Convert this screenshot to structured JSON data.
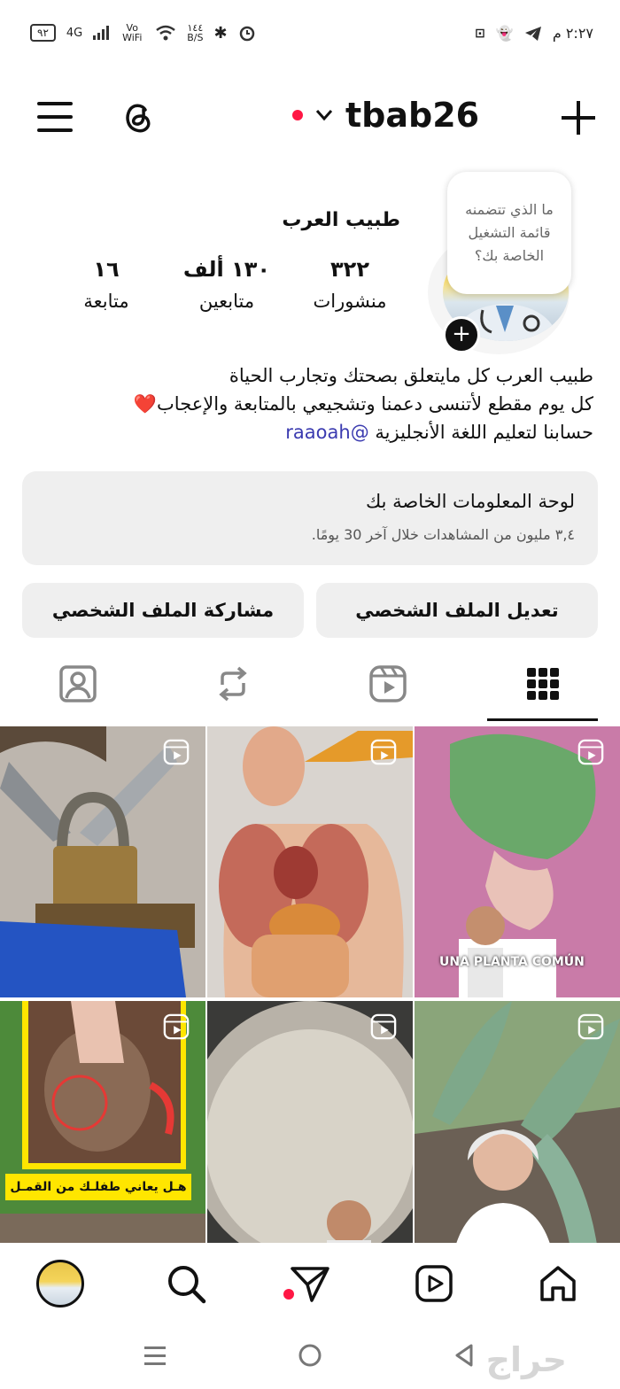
{
  "status_bar": {
    "battery": "٩٢",
    "network": "4G",
    "vowifi": "Vo WiFi",
    "speed_value": "١٤٤",
    "speed_unit": "B/S",
    "time": "٢:٢٧ م"
  },
  "header": {
    "username": "tbab26"
  },
  "profile": {
    "name": "طبيب العرب",
    "note": "ما الذي تتضمنه قائمة التشغيل الخاصة بك؟",
    "stats": [
      {
        "value": "٣٢٢",
        "label": "منشورات"
      },
      {
        "value": "١٣٠ ألف",
        "label": "متابعين"
      },
      {
        "value": "١٦",
        "label": "متابعة"
      }
    ],
    "bio_line1": "طبيب العرب كل مايتعلق بصحتك وتجارب الحياة",
    "bio_line2": "كل يوم مقطع لأتنسى دعمنا وتشجيعي بالمتابعة والإعجاب",
    "bio_emoji": "❤️",
    "bio_line3_text": "حسابنا لتعليم اللغة الأنجليزية",
    "bio_link": "raaoah"
  },
  "dashboard": {
    "title": "لوحة المعلومات الخاصة بك",
    "subtitle": "٣,٤ مليون من المشاهدات خلال آخر 30 يومًا."
  },
  "buttons": {
    "edit_profile": "تعديل الملف الشخصي",
    "share_profile": "مشاركة الملف الشخصي"
  },
  "tabs": [
    {
      "name": "grid-icon",
      "active": true
    },
    {
      "name": "reels-icon",
      "active": false
    },
    {
      "name": "reposts-icon",
      "active": false
    },
    {
      "name": "tagged-icon",
      "active": false
    }
  ],
  "posts": {
    "caption_lice": "هـل يعاني طفلـك من القمـل",
    "caption_plant": "UNA PLANTA COMÚN"
  },
  "bottom_nav": [
    "home-icon",
    "reels-icon",
    "direct-icon",
    "search-icon",
    "profile-avatar"
  ],
  "watermark": "حراج"
}
